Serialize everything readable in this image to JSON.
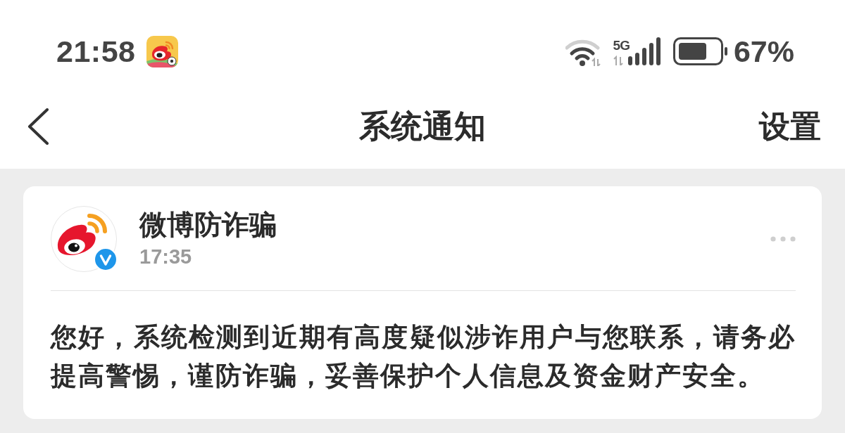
{
  "status_bar": {
    "time": "21:58",
    "network": "5G",
    "battery": "67%"
  },
  "header": {
    "title": "系统通知",
    "action": "设置"
  },
  "notifications": [
    {
      "sender": "微博防诈骗",
      "verified": true,
      "time": "17:35",
      "message": "您好，系统检测到近期有高度疑似涉诈用户与您联系，请务必提高警惕，谨防诈骗，妥善保护个人信息及资金财产安全。"
    }
  ]
}
